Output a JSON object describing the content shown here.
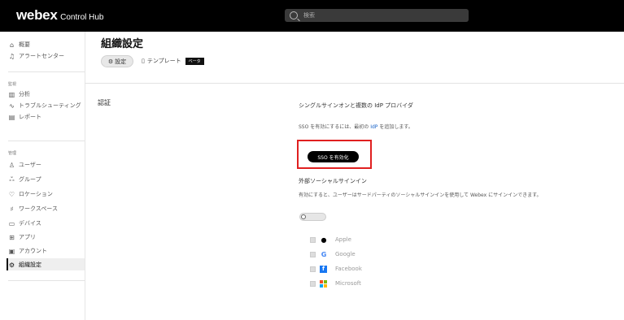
{
  "header": {
    "brand": "webex",
    "product": "Control Hub",
    "search_placeholder": "検索",
    "search_icon": "search-icon"
  },
  "sidebar": {
    "top_items": [
      {
        "icon": "home-icon",
        "label": "概要"
      },
      {
        "icon": "bell-icon",
        "label": "アラートセンター"
      }
    ],
    "monitoring_label": "監視",
    "monitoring_items": [
      {
        "icon": "chart-icon",
        "label": "分析"
      },
      {
        "icon": "pulse-icon",
        "label": "トラブルシューティング"
      },
      {
        "icon": "document-icon",
        "label": "レポート"
      }
    ],
    "management_label": "管理",
    "management_items": [
      {
        "icon": "user-icon",
        "label": "ユーザー"
      },
      {
        "icon": "group-icon",
        "label": "グループ"
      },
      {
        "icon": "location-icon",
        "label": "ロケーション"
      },
      {
        "icon": "workspace-icon",
        "label": "ワークスペース"
      },
      {
        "icon": "device-icon",
        "label": "デバイス"
      },
      {
        "icon": "apps-icon",
        "label": "アプリ"
      },
      {
        "icon": "account-icon",
        "label": "アカウント"
      },
      {
        "icon": "gear-icon",
        "label": "組織設定"
      }
    ]
  },
  "main": {
    "title": "組織設定",
    "tabs": [
      {
        "icon": "gear-icon",
        "label": "設定"
      },
      {
        "icon": "template-icon",
        "label": "テンプレート",
        "badge": "ベータ"
      }
    ],
    "section_title": "認証",
    "sso": {
      "title": "シングルサインオンと複数の IdP プロバイダ",
      "desc_before": "SSO を有効にするには、最初の ",
      "desc_link": "IdP",
      "desc_after": " を追加します。",
      "button_label": "SSO を有効化"
    },
    "external": {
      "title": "外部ソーシャルサインイン",
      "description": "有効にすると、ユーザーはサードパーティのソーシャルサインインを使用して Webex にサインインできます。",
      "toggle_on": false
    },
    "providers": [
      {
        "icon": "apple-icon",
        "glyph": "",
        "label": "Apple",
        "color": "#000000"
      },
      {
        "icon": "google-icon",
        "glyph": "G",
        "label": "Google",
        "color": "#4285F4"
      },
      {
        "icon": "facebook-icon",
        "glyph": "f",
        "label": "Facebook",
        "color": "#1877F2"
      },
      {
        "icon": "microsoft-icon",
        "glyph": "■",
        "label": "Microsoft",
        "color": "#F25022"
      }
    ]
  },
  "colors": {
    "highlight": "#e02020",
    "topbar": "#000000",
    "link": "#1863c8"
  }
}
